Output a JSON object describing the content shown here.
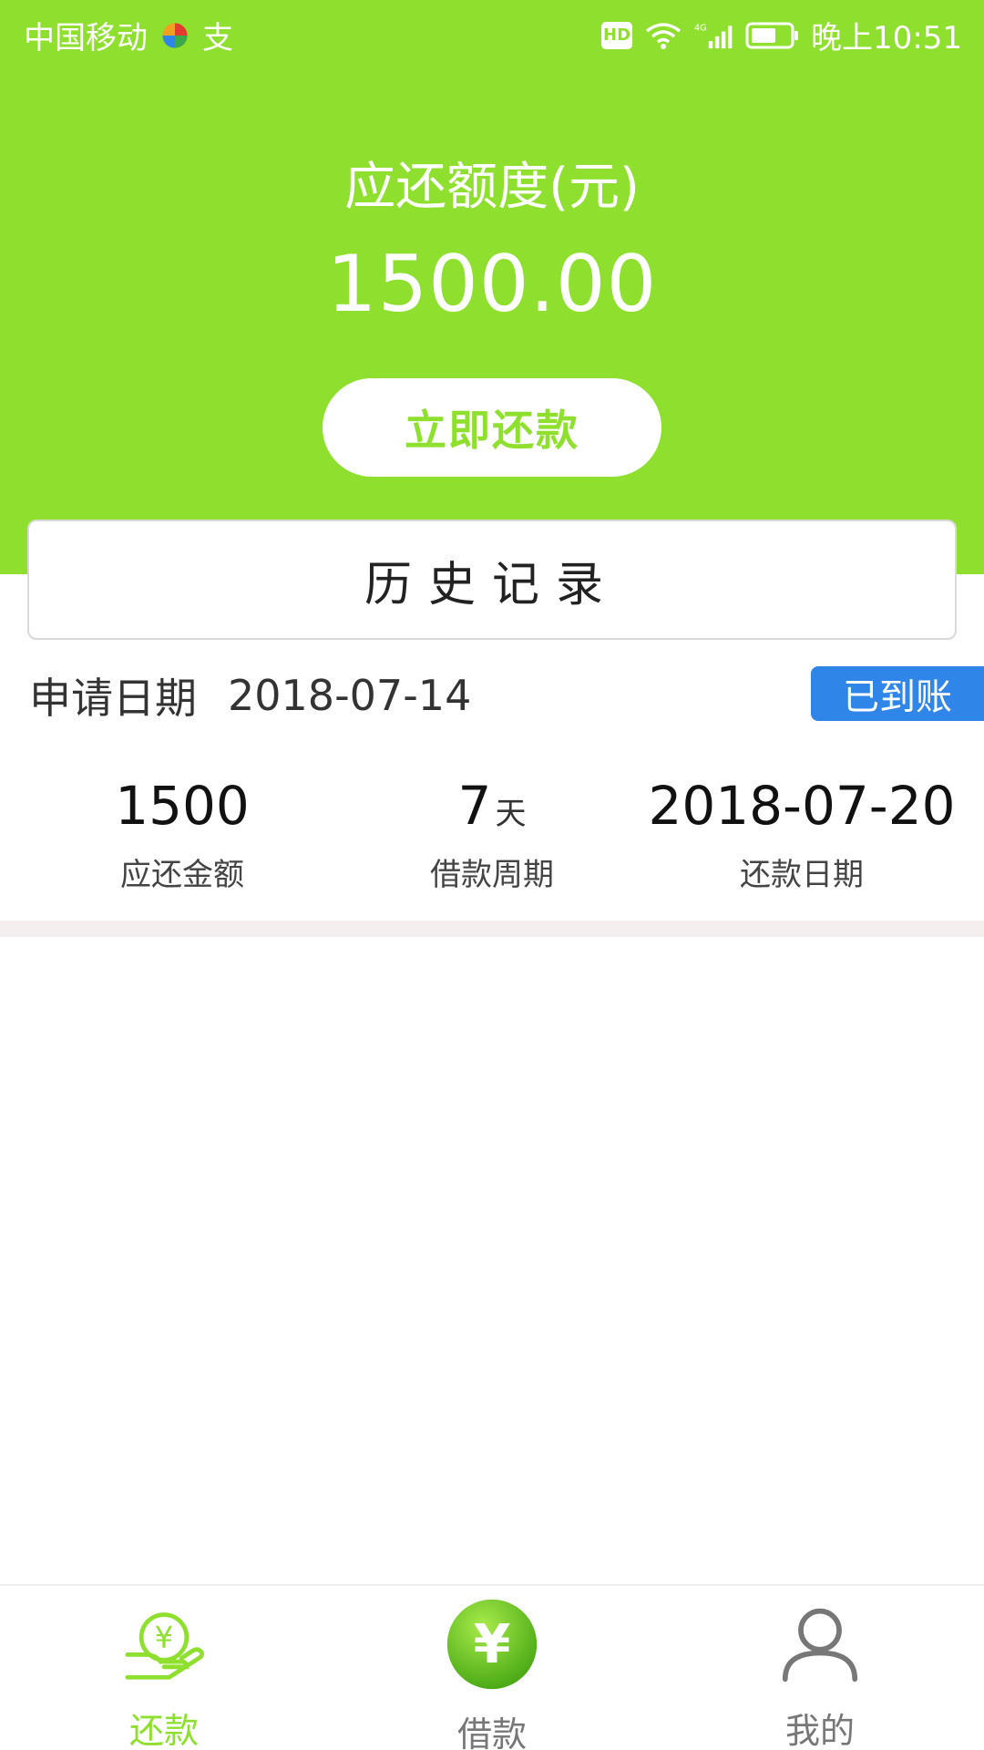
{
  "status_bar": {
    "carrier": "中国移动",
    "extra_icon_text": "支",
    "hd": "HD",
    "network": "4G",
    "time": "晚上10:51"
  },
  "summary": {
    "title": "应还额度(元)",
    "amount": "1500.00",
    "repay_button": "立即还款"
  },
  "history": {
    "title": "历史记录"
  },
  "record": {
    "apply_label": "申请日期",
    "apply_date": "2018-07-14",
    "status": "已到账",
    "stats": {
      "amount": {
        "value": "1500",
        "label": "应还金额"
      },
      "period": {
        "value": "7",
        "unit": "天",
        "label": "借款周期"
      },
      "due": {
        "value": "2018-07-20",
        "label": "还款日期"
      }
    }
  },
  "nav": {
    "items": [
      {
        "label": "还款",
        "icon": "hand-yen-icon"
      },
      {
        "label": "借款",
        "icon": "yen-circle-icon"
      },
      {
        "label": "我的",
        "icon": "person-icon"
      }
    ]
  },
  "colors": {
    "brand_green": "#8FE02E",
    "status_blue": "#2F86E8",
    "nav_inactive": "#777777"
  }
}
